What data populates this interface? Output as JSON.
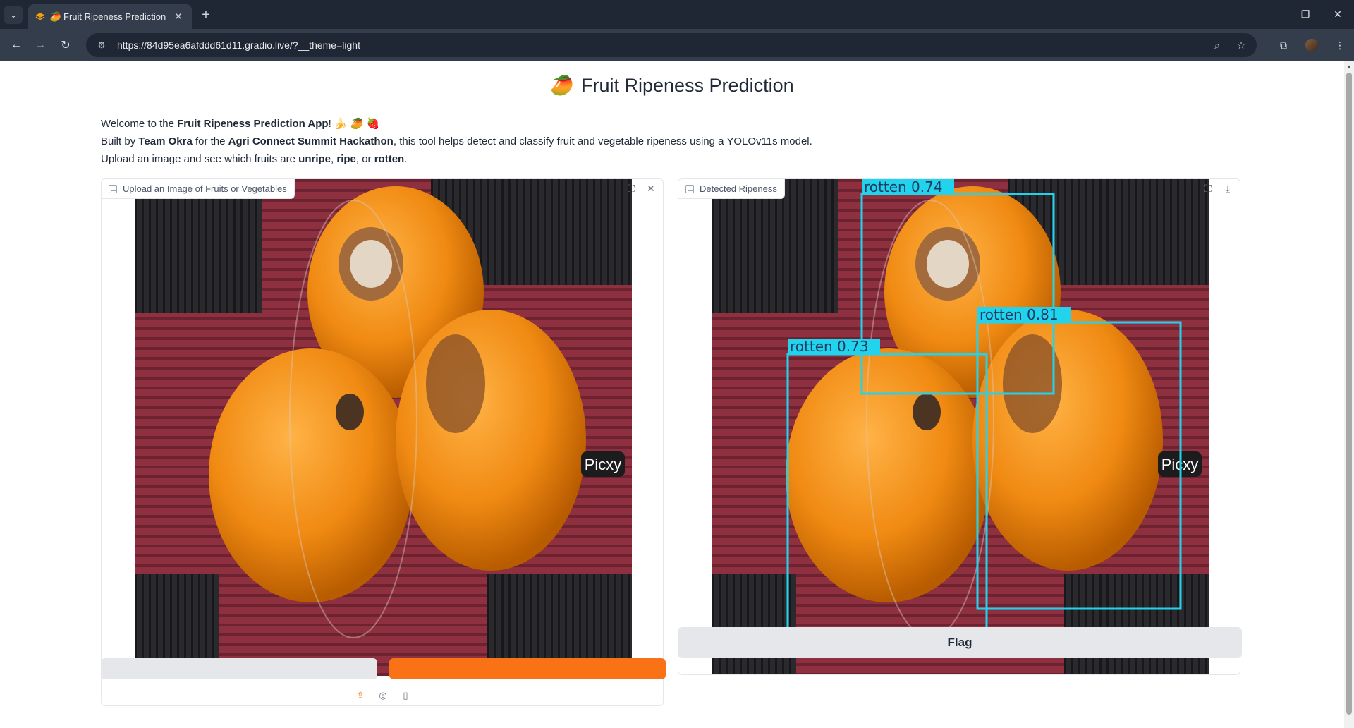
{
  "browser": {
    "tab_title": "Fruit Ripeness Prediction",
    "url": "https://84d95ea6afddd61d11.gradio.live/?__theme=light"
  },
  "app": {
    "title_emoji": "🥭",
    "title": "Fruit Ripeness Prediction",
    "intro": {
      "line1_pre": "Welcome to the ",
      "line1_bold": "Fruit Ripeness Prediction App",
      "line1_post": "! 🍌 🥭 🍓",
      "line2_pre": "Built by ",
      "line2_team": "Team Okra",
      "line2_mid": " for the ",
      "line2_event": "Agri Connect Summit Hackathon",
      "line2_post": ", this tool helps detect and classify fruit and vegetable ripeness using a YOLOv11s model.",
      "line3_pre": "Upload an image and see which fruits are ",
      "line3_unripe": "unripe",
      "line3_sep1": ", ",
      "line3_ripe": "ripe",
      "line3_sep2": ", or ",
      "line3_rotten": "rotten",
      "line3_post": "."
    },
    "input_panel": {
      "label": "Upload an Image of Fruits or Vegetables",
      "watermark": "Picxy"
    },
    "output_panel": {
      "label": "Detected Ripeness",
      "watermark": "Picxy",
      "detections": [
        {
          "label": "rotten 0.74"
        },
        {
          "label": "rotten 0.81"
        },
        {
          "label": "rotten 0.73"
        }
      ]
    },
    "flag_label": "Flag"
  },
  "colors": {
    "accent": "#f97316",
    "box": "#22d3ee"
  }
}
